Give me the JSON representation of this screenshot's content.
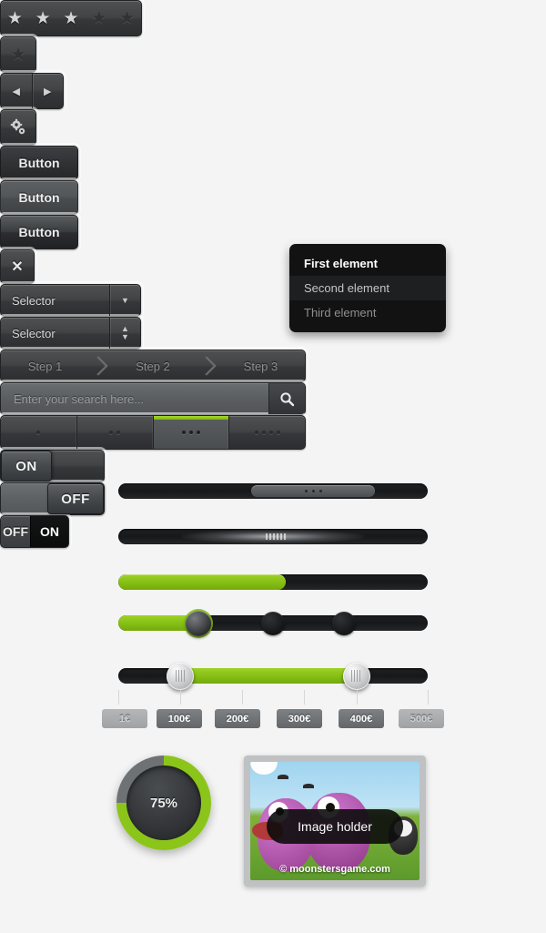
{
  "theme": {
    "background": "#f4f4f4",
    "accent_green": "#86c016",
    "dark_metal": "#35373a"
  },
  "rating": {
    "stars_total": 5,
    "stars_filled": 3,
    "star_glyph": "★",
    "single_star_glyph": "★"
  },
  "nav_arrows": {
    "prev_glyph": "◀",
    "next_glyph": "▶"
  },
  "gear_button": {
    "icon": "gear-icon"
  },
  "buttons": {
    "button1_label": "Button",
    "button2_label": "Button",
    "button3_label": "Button",
    "close_label": "✕"
  },
  "selectors": {
    "first": {
      "label": "Selector",
      "arrow": "▼"
    },
    "second": {
      "label": "Selector",
      "arrow_up": "▲",
      "arrow_down": "▼"
    }
  },
  "dropdown": {
    "items": [
      {
        "label": "First element",
        "state": "selected"
      },
      {
        "label": "Second element",
        "state": "hover"
      },
      {
        "label": "Third element",
        "state": "normal"
      }
    ]
  },
  "steps": {
    "items": [
      {
        "label": "Step 1"
      },
      {
        "label": "Step 2"
      },
      {
        "label": "Step 3"
      }
    ]
  },
  "search": {
    "placeholder": "Enter your search here...",
    "value": "",
    "button_icon": "search-icon"
  },
  "segmented": {
    "active_index": 2,
    "items": [
      {
        "dots": 1
      },
      {
        "dots": 2
      },
      {
        "dots": 3
      },
      {
        "dots": 4
      }
    ]
  },
  "toggles": {
    "first": {
      "state": "on",
      "label": "ON"
    },
    "second": {
      "state": "off",
      "label": "OFF"
    },
    "third": {
      "off_label": "OFF",
      "on_label": "ON",
      "state": "on"
    }
  },
  "scrollbar": {
    "handle_dots": 3,
    "handle_position_percent": 43
  },
  "loader": {
    "type": "indeterminate"
  },
  "progress_bar": {
    "value_percent": 54
  },
  "slider_single": {
    "value_percent": 26,
    "notch_positions_percent": [
      50,
      73
    ]
  },
  "slider_range": {
    "min_percent": 20,
    "max_percent": 77,
    "tick_positions_percent": [
      0,
      20,
      40,
      60,
      77,
      100
    ]
  },
  "price_ticks": [
    {
      "label": "1€",
      "dim": true
    },
    {
      "label": "100€",
      "dim": false
    },
    {
      "label": "200€",
      "dim": false
    },
    {
      "label": "300€",
      "dim": false
    },
    {
      "label": "400€",
      "dim": false
    },
    {
      "label": "500€",
      "dim": true
    }
  ],
  "dial": {
    "value_label": "75%",
    "value_percent": 75
  },
  "image_holder": {
    "caption": "Image holder",
    "credit": "© moonstersgame.com"
  }
}
